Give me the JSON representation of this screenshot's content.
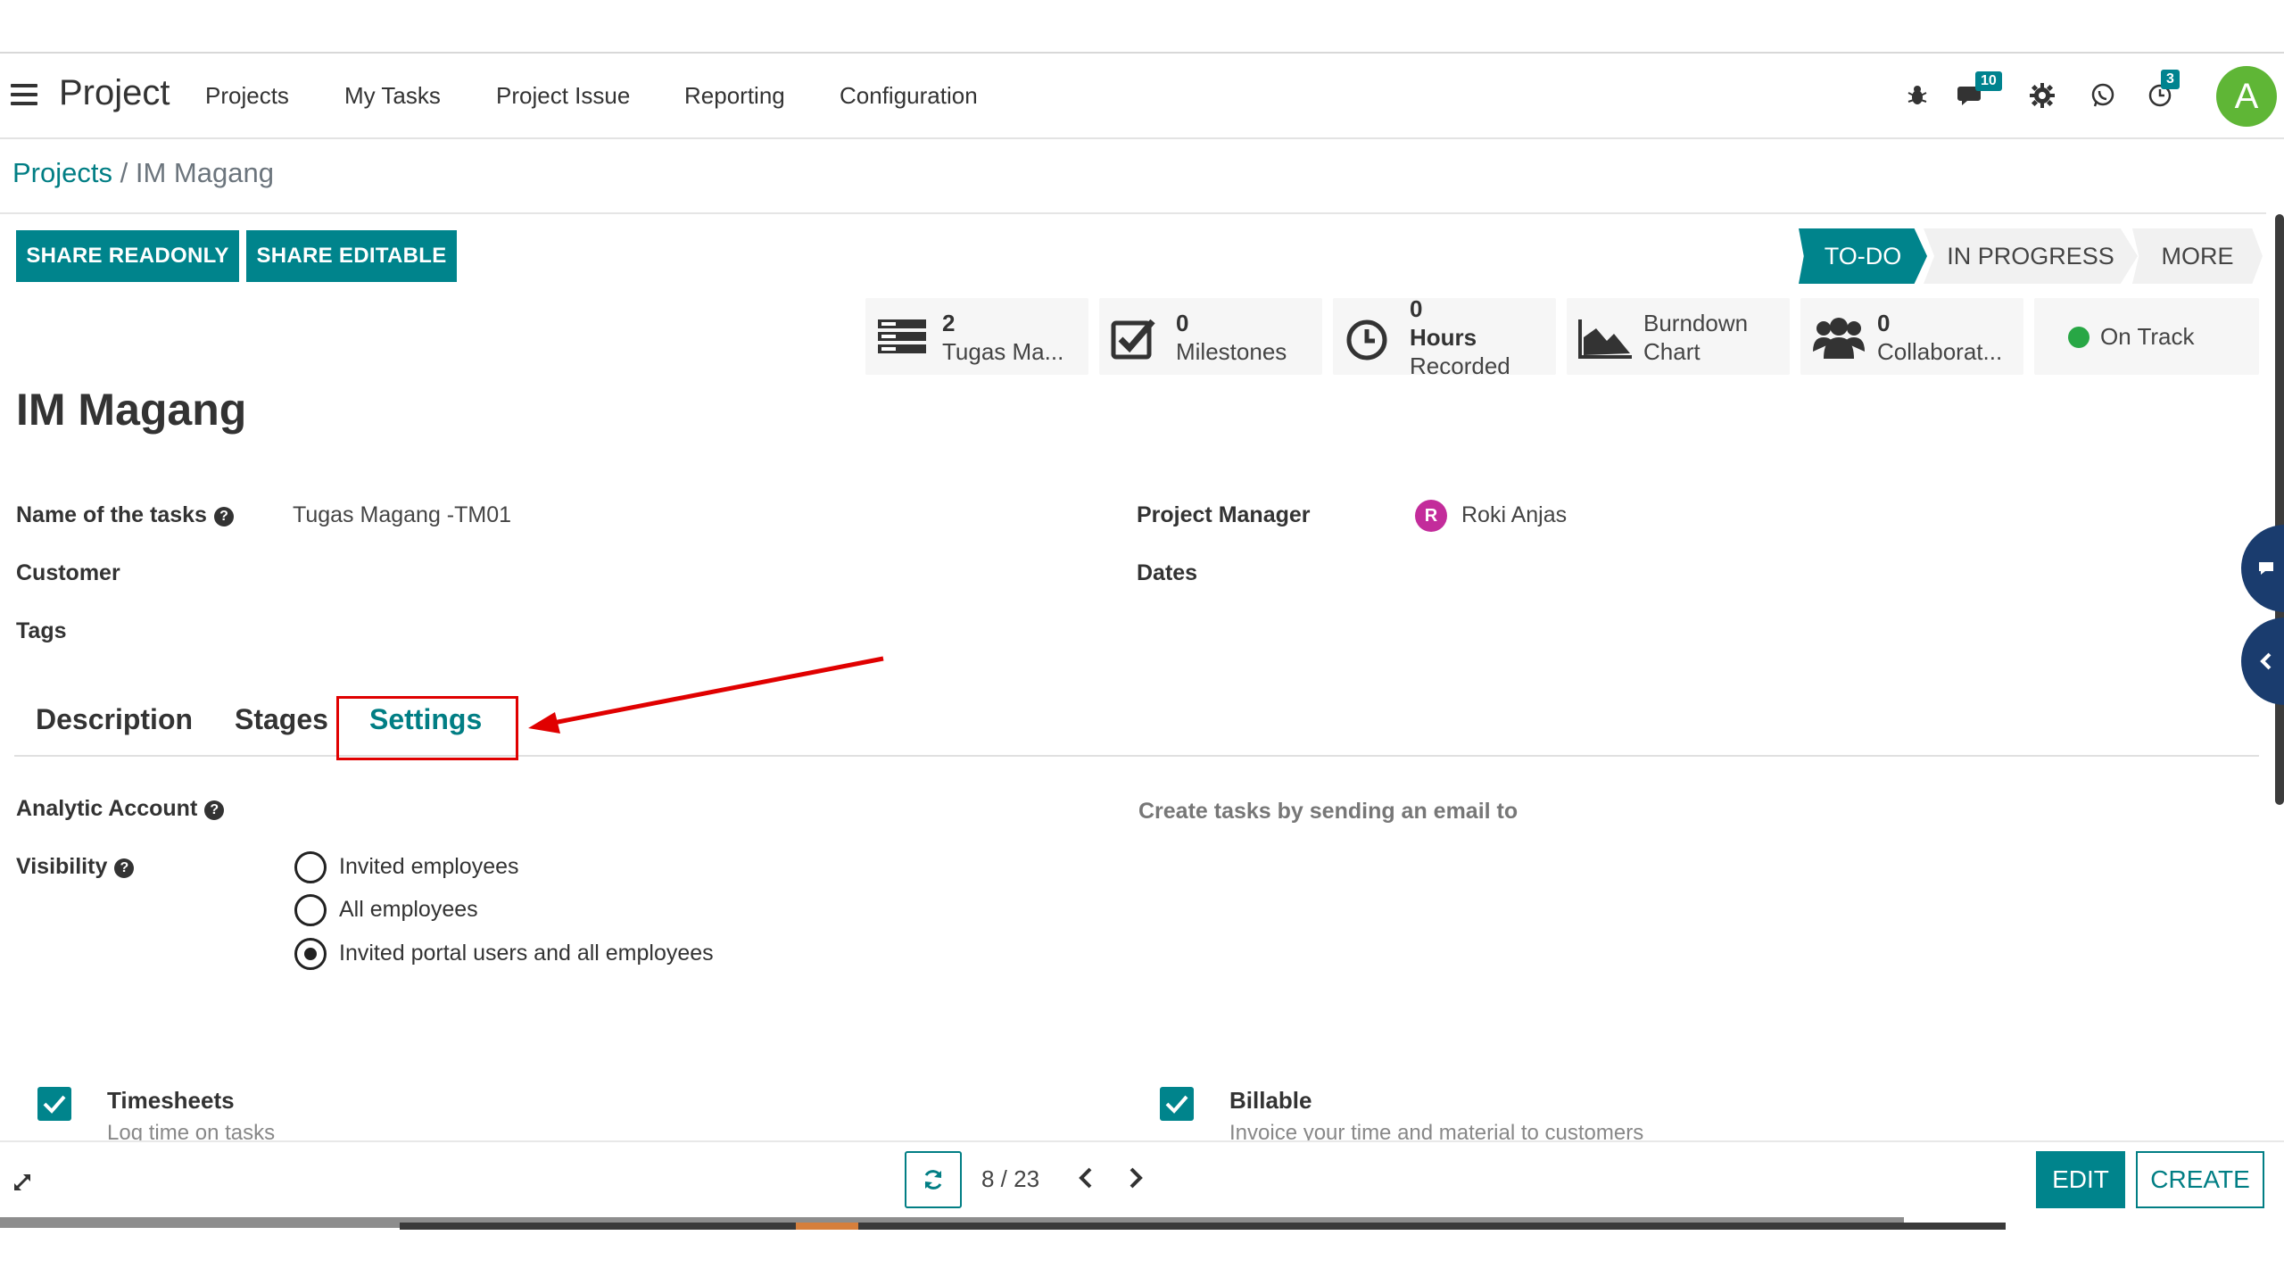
{
  "navbar": {
    "app_name": "Project",
    "menu": [
      "Projects",
      "My Tasks",
      "Project Issue",
      "Reporting",
      "Configuration"
    ],
    "icons": [
      "bug-icon",
      "chat-icon",
      "gear-icon",
      "whatsapp-icon",
      "activity-clock-icon"
    ],
    "messages_badge": "10",
    "activities_badge": "3",
    "user_avatar_letter": "A"
  },
  "breadcrumb": {
    "parent": "Projects",
    "separator": "/",
    "current": "IM Magang"
  },
  "actions": {
    "share_readonly": "SHARE READONLY",
    "share_editable": "SHARE EDITABLE"
  },
  "stages": {
    "todo": "TO-DO",
    "in_progress": "IN PROGRESS",
    "more": "MORE"
  },
  "smart_buttons": {
    "tasks": {
      "value": "2",
      "label": "Tugas Ma..."
    },
    "milestones": {
      "value": "0",
      "label": "Milestones"
    },
    "hours": {
      "value": "0",
      "line1": "Hours",
      "line2": "Recorded"
    },
    "burndown": {
      "line1": "Burndown",
      "line2": "Chart"
    },
    "collaborators": {
      "value": "0",
      "label": "Collaborat..."
    },
    "status": {
      "label": "On Track",
      "color": "#28a745"
    }
  },
  "record": {
    "title": "IM Magang",
    "name_of_tasks_label": "Name of the tasks",
    "name_of_tasks_value": "Tugas Magang -TM01",
    "customer_label": "Customer",
    "tags_label": "Tags",
    "project_manager_label": "Project Manager",
    "project_manager_initial": "R",
    "project_manager_value": "Roki Anjas",
    "dates_label": "Dates"
  },
  "tabs": {
    "description": "Description",
    "stages": "Stages",
    "settings": "Settings"
  },
  "settings": {
    "analytic_account_label": "Analytic Account",
    "email_hint": "Create tasks by sending an email to",
    "visibility_label": "Visibility",
    "visibility_options": [
      "Invited employees",
      "All employees",
      "Invited portal users and all employees"
    ],
    "visibility_selected": 2,
    "timesheets_title": "Timesheets",
    "timesheets_sub": "Log time on tasks",
    "billable_title": "Billable",
    "billable_sub": "Invoice your time and material to customers"
  },
  "pager": {
    "text": "8 / 23"
  },
  "bottom": {
    "edit": "EDIT",
    "create": "CREATE"
  },
  "colors": {
    "primary": "#00848c",
    "annotation": "#e00000"
  }
}
